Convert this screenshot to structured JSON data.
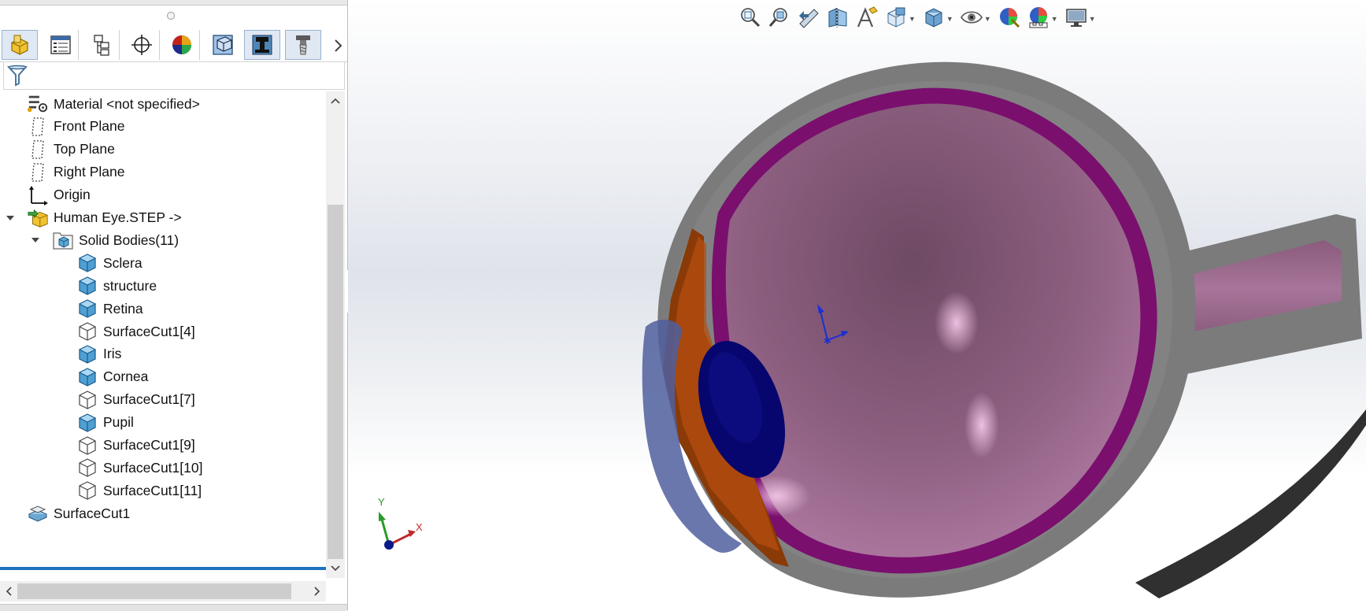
{
  "toolbar_tabs": [
    {
      "name": "featuremanager-tab",
      "icon": "featuremanager-icon",
      "active": true
    },
    {
      "name": "propertymanager-tab",
      "icon": "propertymanager-icon"
    },
    {
      "name": "configurationmanager-tab",
      "icon": "configurationmanager-icon"
    },
    {
      "name": "dimxpertmanager-tab",
      "icon": "dimxpert-icon"
    },
    {
      "name": "displaymanager-tab",
      "icon": "displaymanager-icon"
    },
    {
      "name": "cam-feature-tab",
      "icon": "cam-feature-icon"
    },
    {
      "name": "cam-operation-tab",
      "icon": "cam-operation-icon"
    },
    {
      "name": "cam-tool-tab",
      "icon": "cam-tool-icon"
    }
  ],
  "tree": {
    "items": [
      {
        "label": "Material <not specified>",
        "icon": "material-icon",
        "indent": 0
      },
      {
        "label": "Front Plane",
        "icon": "plane-icon",
        "indent": 0
      },
      {
        "label": "Top Plane",
        "icon": "plane-icon",
        "indent": 0
      },
      {
        "label": "Right Plane",
        "icon": "plane-icon",
        "indent": 0
      },
      {
        "label": "Origin",
        "icon": "origin-icon",
        "indent": 0
      },
      {
        "label": "Human Eye.STEP ->",
        "icon": "imported-part-icon",
        "indent": 0,
        "expanded": true
      },
      {
        "label": "Solid Bodies(11)",
        "icon": "solid-bodies-folder-icon",
        "indent": 1,
        "expanded": true
      },
      {
        "label": "Sclera",
        "icon": "solid-body-icon",
        "indent": 2
      },
      {
        "label": "structure",
        "icon": "solid-body-icon",
        "indent": 2
      },
      {
        "label": "Retina",
        "icon": "solid-body-icon",
        "indent": 2
      },
      {
        "label": "SurfaceCut1[4]",
        "icon": "hidden-body-icon",
        "indent": 2
      },
      {
        "label": "Iris",
        "icon": "solid-body-icon",
        "indent": 2
      },
      {
        "label": "Cornea",
        "icon": "solid-body-icon",
        "indent": 2
      },
      {
        "label": "SurfaceCut1[7]",
        "icon": "hidden-body-icon",
        "indent": 2
      },
      {
        "label": "Pupil",
        "icon": "solid-body-icon",
        "indent": 2
      },
      {
        "label": "SurfaceCut1[9]",
        "icon": "hidden-body-icon",
        "indent": 2
      },
      {
        "label": "SurfaceCut1[10]",
        "icon": "hidden-body-icon",
        "indent": 2
      },
      {
        "label": "SurfaceCut1[11]",
        "icon": "hidden-body-icon",
        "indent": 2
      },
      {
        "label": "SurfaceCut1",
        "icon": "surface-cut-feature-icon",
        "indent": 0
      }
    ]
  },
  "heads_up_toolbar": [
    {
      "name": "zoom-to-fit",
      "icon": "zoom-to-fit-icon"
    },
    {
      "name": "zoom-to-area",
      "icon": "zoom-to-area-icon"
    },
    {
      "name": "previous-view",
      "icon": "previous-view-icon"
    },
    {
      "name": "section-view",
      "icon": "section-view-icon"
    },
    {
      "name": "dynamic-annotation-views",
      "icon": "dynamic-annotation-icon"
    },
    {
      "name": "view-orientation",
      "icon": "view-orientation-icon",
      "dropdown": true
    },
    {
      "name": "display-style",
      "icon": "display-style-icon",
      "dropdown": true
    },
    {
      "name": "hide-show-items",
      "icon": "hide-show-icon",
      "dropdown": true
    },
    {
      "name": "edit-appearance",
      "icon": "edit-appearance-icon"
    },
    {
      "name": "apply-scene",
      "icon": "apply-scene-icon",
      "dropdown": true
    },
    {
      "name": "view-settings",
      "icon": "view-settings-icon",
      "dropdown": true
    }
  ],
  "triad": {
    "x_label": "X",
    "y_label": "Y"
  },
  "colors": {
    "sclera": "#7b7b7b",
    "choroid": "#7a0f6e",
    "vitreous": "#b07aa3",
    "cornea": "#5a6aa8",
    "iris": "#a04a0a",
    "lens": "#0a0a7a",
    "selection_blue": "#1e73be"
  }
}
